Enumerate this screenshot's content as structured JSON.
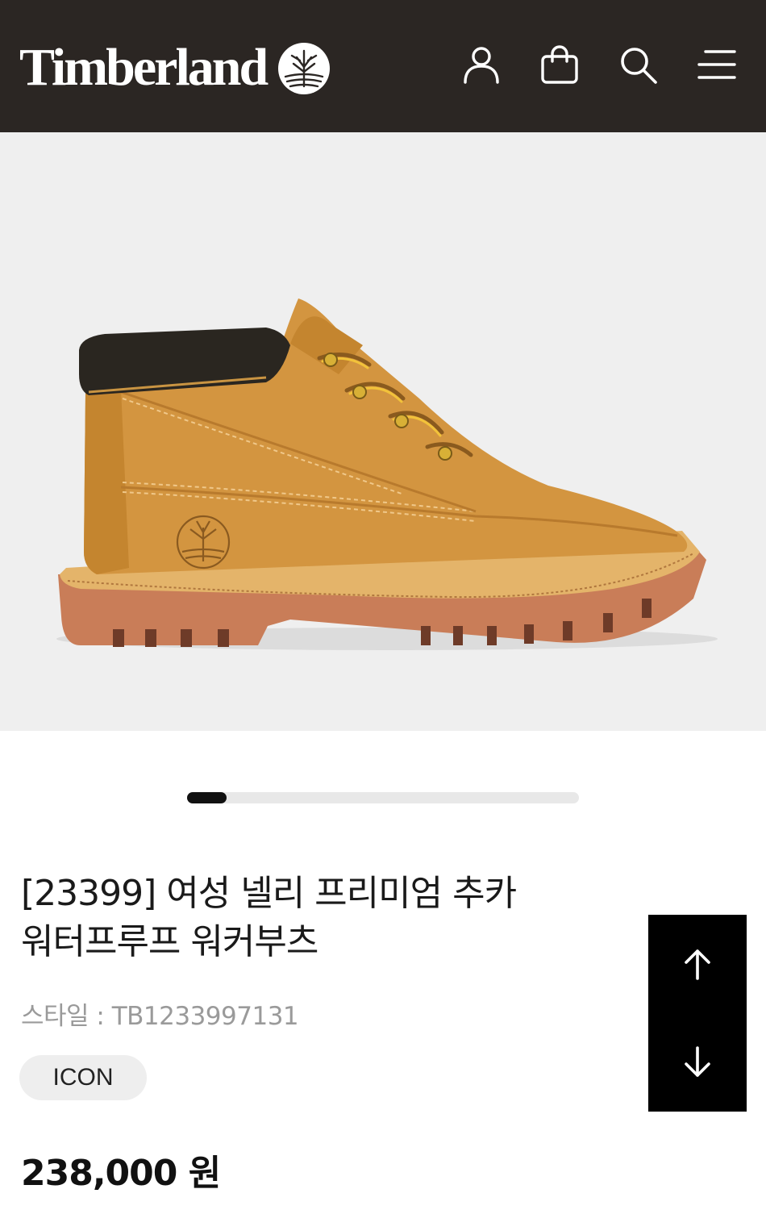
{
  "header": {
    "brand": "Timberland",
    "icons": [
      "account-icon",
      "cart-icon",
      "search-icon",
      "menu-icon"
    ]
  },
  "gallery": {
    "image": "product-image",
    "progress": 0.1
  },
  "product": {
    "title_line1": "[23399] 여성 넬리 프리미엄 추카",
    "title_line2": "워터프루프 워커부츠",
    "style_label": "스타일 : TB1233997131",
    "badge": "ICON",
    "price": "238,000 원"
  },
  "scroll": {
    "up_icon": "arrow-up-icon",
    "down_icon": "arrow-down-icon"
  },
  "colors": {
    "header_bg": "#2b2623",
    "hero_bg": "#efefef",
    "boot": "#d0923e",
    "sole": "#c77c57"
  }
}
